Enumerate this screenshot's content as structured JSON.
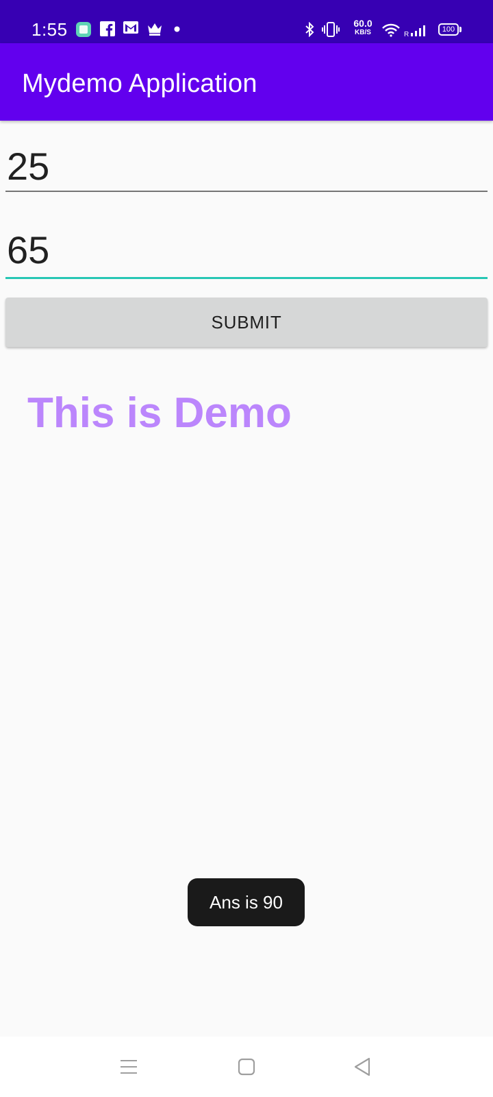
{
  "status_bar": {
    "time": "1:55",
    "notification_icons": [
      "app-icon",
      "facebook-icon",
      "gmail-icon",
      "crown-icon",
      "dot-icon"
    ],
    "system_icons": [
      "bluetooth-icon",
      "vibrate-icon",
      "wifi-icon",
      "signal-icon",
      "battery-icon"
    ],
    "net_speed": "60.0",
    "net_speed_unit": "KB/S",
    "signal_label": "R",
    "battery": "100",
    "color": "#3700b3"
  },
  "app_bar": {
    "title": "Mydemo Application",
    "color": "#6200ee"
  },
  "form": {
    "first_value": "25",
    "second_value": "65",
    "submit_label": "SUBMIT",
    "focus_color": "#26c6b4"
  },
  "content": {
    "demo_text": "This is Demo",
    "demo_color": "#bb86fc"
  },
  "toast": {
    "message": "Ans is 90"
  },
  "nav_bar": {
    "buttons": [
      "menu-icon",
      "home-icon",
      "back-icon"
    ]
  }
}
